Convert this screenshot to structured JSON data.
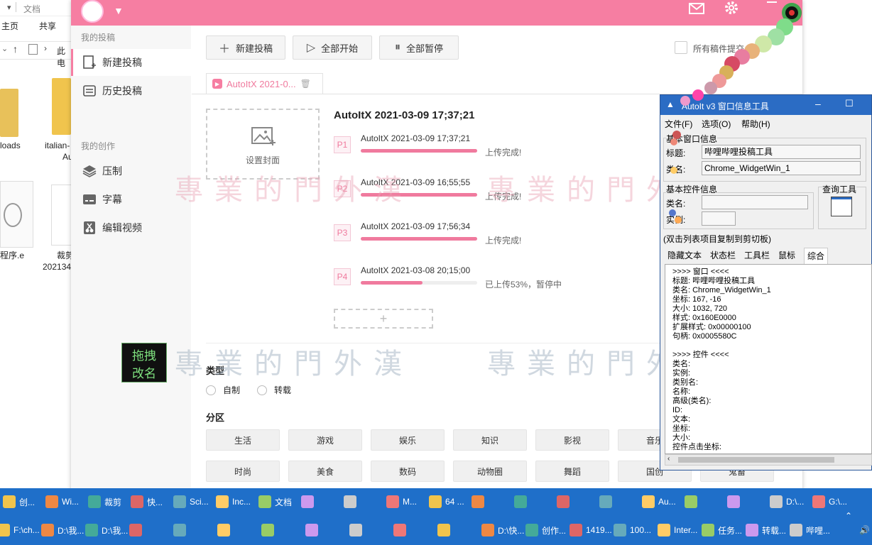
{
  "explorer": {
    "title": "文档",
    "tabs": [
      "主页",
      "共享"
    ],
    "address": "此电",
    "files": [
      {
        "name": "loads",
        "kind": "folder"
      },
      {
        "name": "italian-",
        "sub": "Au",
        "kind": "folder"
      },
      {
        "name": "程序.e",
        "kind": "file"
      },
      {
        "name": "裁剪",
        "sub": "202134",
        "kind": "doc"
      }
    ]
  },
  "bili": {
    "sidebar": {
      "section_1": "我的投稿",
      "items_1": [
        {
          "label": "新建投稿",
          "icon": "upload-icon"
        },
        {
          "label": "历史投稿",
          "icon": "history-icon"
        }
      ],
      "section_2": "我的创作",
      "items_2": [
        {
          "label": "压制",
          "icon": "layers-icon"
        },
        {
          "label": "字幕",
          "icon": "subtitle-icon"
        },
        {
          "label": "编辑视频",
          "icon": "scissors-icon"
        }
      ]
    },
    "toolbar": {
      "new_label": "新建投稿",
      "start_all_label": "全部开始",
      "pause_all_label": "全部暂停",
      "apply_all_label": "所有稿件提交"
    },
    "tab_label": "AutoItX 2021-0...",
    "cover_label": "设置封面",
    "upload_title": "AutoItX 2021-03-09 17;37;21",
    "parts": [
      {
        "badge": "P1",
        "name": "AutoItX 2021-03-09 17;37;21",
        "progress": 1.0,
        "status": "上传完成!"
      },
      {
        "badge": "P2",
        "name": "AutoItX 2021-03-09 16;55;55",
        "progress": 1.0,
        "status": "上传完成!"
      },
      {
        "badge": "P3",
        "name": "AutoItX 2021-03-09 17;56;34",
        "progress": 1.0,
        "status": "上传完成!"
      },
      {
        "badge": "P4",
        "name": "AutoItX 2021-03-08 20;15;00",
        "progress": 0.53,
        "status": "已上传53%，暂停中"
      }
    ],
    "add_part": "+",
    "type_heading": "类型",
    "type_options": [
      "自制",
      "转载"
    ],
    "zone_heading": "分区",
    "zones_row1": [
      "生活",
      "游戏",
      "娱乐",
      "知识",
      "影视",
      "音乐"
    ],
    "zones_row2": [
      "时尚",
      "美食",
      "数码",
      "动物圈",
      "舞蹈",
      "国创",
      "鬼畜"
    ]
  },
  "overlay_badge": {
    "line1": "拖拽",
    "line2": "改名"
  },
  "watermark": "專業的門外漢",
  "autoit": {
    "title": "AutoIt v3 窗口信息工具",
    "menu": [
      "文件(F)",
      "选项(O)",
      "帮助(H)"
    ],
    "basic_window": "基本窗口信息",
    "title_label": "标题:",
    "title_value": "哔哩哔哩投稿工具",
    "class_label": "类名:",
    "class_value": "Chrome_WidgetWin_1",
    "basic_control": "基本控件信息",
    "ctrl_class_label": "类名:",
    "instance_label": "实例:",
    "finder_label": "查询工具",
    "copy_hint": "(双击列表项目复制到剪切板)",
    "tabs": [
      "隐藏文本",
      "状态栏",
      "工具栏",
      "鼠标",
      "综合"
    ],
    "lines": [
      ">>>> 窗口 <<<<",
      "标题:      哔哩哔哩投稿工具",
      "类名:      Chrome_WidgetWin_1",
      "坐标:      167, -16",
      "大小:      1032, 720",
      "样式:      0x160E0000",
      "扩展样式: 0x00000100",
      "句柄:      0x0005580C",
      "",
      ">>>> 控件 <<<<",
      "类名:",
      "实例:",
      "类别名:",
      "名称:",
      "高级(类名):",
      "ID:",
      "文本:",
      "坐标:",
      "大小:",
      "控件点击坐标:"
    ]
  },
  "taskbar": {
    "row1": [
      "创...",
      "Wi...",
      "裁剪",
      "快...",
      "Sci...",
      "Inc...",
      "文档",
      "",
      "",
      "M...",
      "64 ...",
      "",
      "",
      "",
      "",
      "Au...",
      "",
      "",
      "D:\\...",
      "G:\\..."
    ],
    "row2": [
      "F:\\ch...",
      "D:\\我...",
      "D:\\我...",
      "",
      "",
      "",
      "",
      "",
      "",
      "",
      "",
      "D:\\快...",
      "创作...",
      "1419...",
      "100...",
      "Inter...",
      "任务...",
      "转载...",
      "哔哩..."
    ]
  },
  "colors": {
    "brand": "#f67ea2",
    "taskbar": "#1f6fc9",
    "autoit_title": "#2b6cc4"
  }
}
